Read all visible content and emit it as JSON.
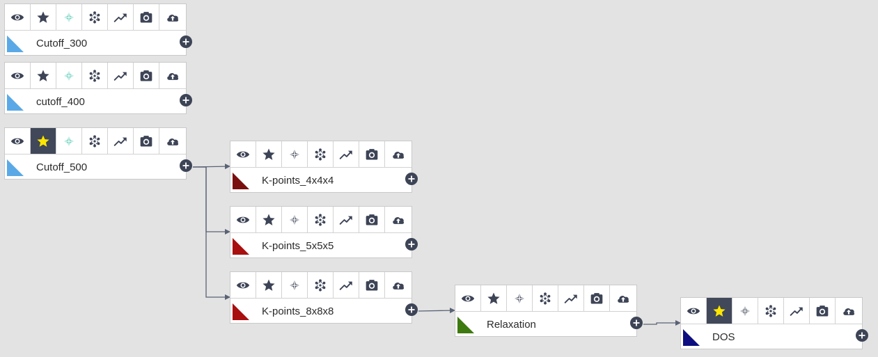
{
  "workflow": {
    "tool_icons": [
      "eye-icon",
      "star-icon",
      "compass-icon",
      "atom-icon",
      "trend-icon",
      "camera-icon",
      "cloud-upload-icon"
    ],
    "nodes": [
      {
        "id": "cutoff_300",
        "label": "Cutoff_300",
        "color": "#5aa9e6",
        "starred": false,
        "compass_color": "#4fc9b4"
      },
      {
        "id": "cutoff_400",
        "label": "cutoff_400",
        "color": "#5aa9e6",
        "starred": false,
        "compass_color": "#4fc9b4"
      },
      {
        "id": "cutoff_500",
        "label": "Cutoff_500",
        "color": "#5aa9e6",
        "starred": true,
        "compass_color": "#4fc9b4"
      },
      {
        "id": "kpoints_4x4x4",
        "label": "K-points_4x4x4",
        "color": "#7a0e0e",
        "starred": false,
        "compass_color": "#3d4456"
      },
      {
        "id": "kpoints_5x5x5",
        "label": "K-points_5x5x5",
        "color": "#a80f0f",
        "starred": false,
        "compass_color": "#3d4456"
      },
      {
        "id": "kpoints_8x8x8",
        "label": "K-points_8x8x8",
        "color": "#a80f0f",
        "starred": false,
        "compass_color": "#3d4456"
      },
      {
        "id": "relaxation",
        "label": "Relaxation",
        "color": "#3d7a10",
        "starred": false,
        "compass_color": "#3d4456"
      },
      {
        "id": "dos",
        "label": "DOS",
        "color": "#0d0d80",
        "starred": true,
        "compass_color": "#3d4456"
      }
    ],
    "edges": [
      {
        "from": "cutoff_500",
        "to": "kpoints_4x4x4"
      },
      {
        "from": "cutoff_500",
        "to": "kpoints_5x5x5"
      },
      {
        "from": "cutoff_500",
        "to": "kpoints_8x8x8"
      },
      {
        "from": "kpoints_8x8x8",
        "to": "relaxation"
      },
      {
        "from": "relaxation",
        "to": "dos"
      }
    ],
    "colors": {
      "icon": "#3d4456",
      "star_active": "#ffe600",
      "active_bg": "#404859",
      "connector": "#5a6275"
    }
  }
}
